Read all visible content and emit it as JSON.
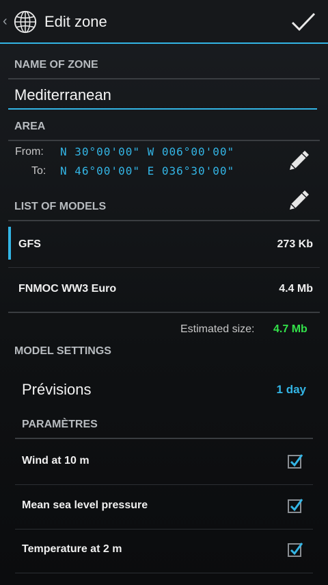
{
  "header": {
    "back_glyph": "‹",
    "title": "Edit zone",
    "app_icon": "globe-icon",
    "confirm_icon": "checkmark-icon"
  },
  "zone_name": {
    "header": "NAME OF ZONE",
    "value": "Mediterranean"
  },
  "area": {
    "header": "AREA",
    "from_label": "From:",
    "from_value": "N 30°00'00\" W 006°00'00\"",
    "to_label": "To:",
    "to_value": "N 46°00'00\" E 036°30'00\""
  },
  "models": {
    "header": "LIST OF MODELS",
    "items": [
      {
        "name": "GFS",
        "size": "273 Kb",
        "selected": true
      },
      {
        "name": "FNMOC WW3 Euro",
        "size": "4.4 Mb",
        "selected": false
      }
    ],
    "estimated_label": "Estimated size:",
    "estimated_value": "4.7 Mb"
  },
  "model_settings": {
    "header": "MODEL SETTINGS",
    "previsions_label": "Prévisions",
    "previsions_value": "1 day",
    "params_header": "PARAMÈTRES",
    "params": [
      {
        "name": "Wind at 10 m",
        "checked": true
      },
      {
        "name": "Mean sea level pressure",
        "checked": true
      },
      {
        "name": "Temperature at 2 m",
        "checked": true
      }
    ]
  },
  "colors": {
    "accent": "#33b5e5",
    "estimate": "#33e24a"
  }
}
